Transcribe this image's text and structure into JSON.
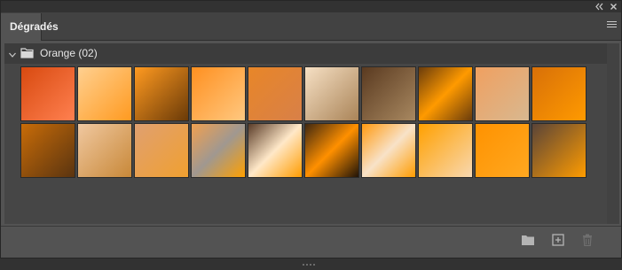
{
  "panel": {
    "title": "Dégradés",
    "collapse_icon": "double-chevron-left-icon",
    "close_icon": "close-icon",
    "menu_icon": "panel-menu-icon"
  },
  "group": {
    "label": "Orange (02)",
    "expanded": true,
    "icon": "folder-icon"
  },
  "gradients": [
    {
      "colors": [
        "#d84a10",
        "#ff8050"
      ],
      "angle": 135
    },
    {
      "colors": [
        "#ffd090",
        "#ff9a20"
      ],
      "angle": 135
    },
    {
      "colors": [
        "#ff9a20",
        "#6a3a08"
      ],
      "angle": 135
    },
    {
      "colors": [
        "#ff9020",
        "#ffc880"
      ],
      "angle": 135
    },
    {
      "colors": [
        "#e88628",
        "#d88048"
      ],
      "angle": 135
    },
    {
      "colors": [
        "#f6e0c4",
        "#aa8458"
      ],
      "angle": 135
    },
    {
      "colors": [
        "#5a3a20",
        "#a88860"
      ],
      "angle": 135
    },
    {
      "colors": [
        "#6a3c0c",
        "#ff9a00",
        "#6a3c0c"
      ],
      "angle": 135
    },
    {
      "colors": [
        "#f0a060",
        "#d8b890"
      ],
      "angle": 135
    },
    {
      "colors": [
        "#d87008",
        "#ff9a00"
      ],
      "angle": 135
    },
    {
      "colors": [
        "#c86c08",
        "#5a3410"
      ],
      "angle": 135
    },
    {
      "colors": [
        "#f0c8a0",
        "#c88838"
      ],
      "angle": 135
    },
    {
      "colors": [
        "#e0a070",
        "#f0a030"
      ],
      "angle": 135
    },
    {
      "colors": [
        "#f0a050",
        "#a09890",
        "#ffa000"
      ],
      "angle": 135
    },
    {
      "colors": [
        "#5a3c28",
        "#ffe8c8",
        "#ff9c00"
      ],
      "angle": 135
    },
    {
      "colors": [
        "#402810",
        "#ff9000",
        "#201408"
      ],
      "angle": 135
    },
    {
      "colors": [
        "#ff9a10",
        "#f8e2c8",
        "#ff9c00"
      ],
      "angle": 135
    },
    {
      "colors": [
        "#ffa000",
        "#f8d8b0"
      ],
      "angle": 135
    },
    {
      "colors": [
        "#ff9200",
        "#ffa820"
      ],
      "angle": 135
    },
    {
      "colors": [
        "#5a4438",
        "#ff9c00"
      ],
      "angle": 135
    }
  ],
  "footer": {
    "new_group_icon": "folder-icon",
    "new_gradient_icon": "plus-square-icon",
    "delete_icon": "trash-icon"
  },
  "colors": {
    "panel_bg": "#535353",
    "content_bg": "#464646",
    "header_bg": "#3c3c3c",
    "text": "#e6e6e6"
  }
}
